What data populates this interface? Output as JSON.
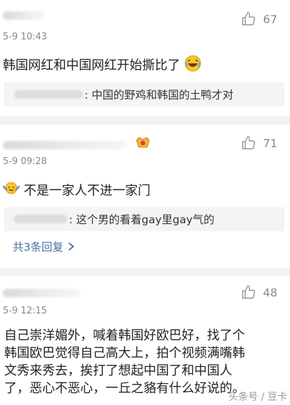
{
  "comments": [
    {
      "timestamp": "5-9 10:43",
      "likes": "67",
      "text": "韩国网红和中国网红开始撕比了",
      "quote": ": 中国的野鸡和韩国的土鸭才对"
    },
    {
      "timestamp": "5-9 09:28",
      "likes": "71",
      "text": "不是一家人不进一家门",
      "quote": ": 这个男的看着gay里gay气的",
      "more_replies": "共3条回复"
    },
    {
      "timestamp": "5-9 12:15",
      "likes": "48",
      "lines": [
        "自己崇洋媚外，喊着韩国好欧巴好，找了个",
        "韩国欧巴觉得自己高大上，拍个视频满嘴韩",
        "文秀来秀去，挨打了想起中国了和中国人",
        "了，恶心不恶心，一丘之貉有什么好说的。"
      ]
    }
  ],
  "watermark": "头条号 / 豆卡",
  "icons": {
    "like": "thumbs-up-icon",
    "reply": "reply-icon",
    "laugh": "laughing-emoji-icon",
    "shrug": "shrug-emoji-icon",
    "vip": "vip-badge-icon",
    "chevron": "chevron-right-icon"
  },
  "colors": {
    "link": "#4a6fa3",
    "meta": "#888888",
    "separator": "#f2f2f2",
    "quote_bg": "#f4f4f4"
  }
}
